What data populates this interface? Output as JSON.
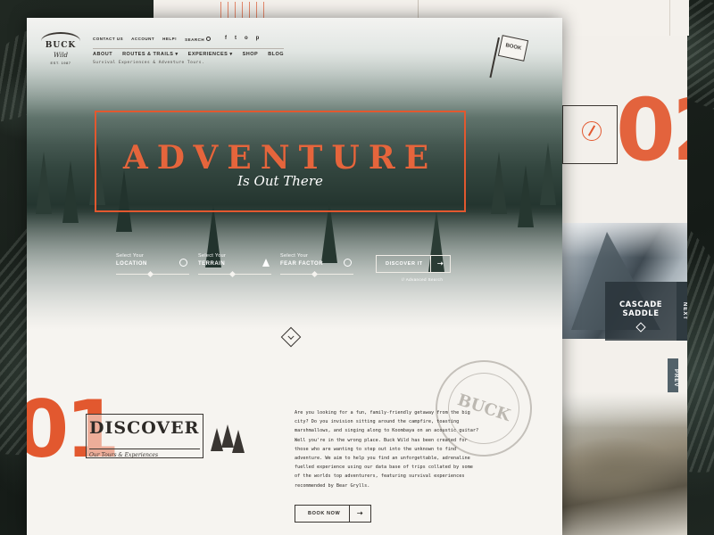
{
  "logo": {
    "name": "BUCK",
    "script": "Wild",
    "est": "EST. 1987"
  },
  "util_nav": {
    "contact": "CONTACT US",
    "account": "ACCOUNT",
    "help": "HELP!",
    "search": "SEARCH"
  },
  "social": [
    "f",
    "t",
    "o",
    "p"
  ],
  "main_nav": {
    "about": "ABOUT",
    "routes": "ROUTES & TRAILS",
    "experiences": "EXPERIENCES",
    "shop": "SHOP",
    "blog": "BLOG"
  },
  "tagline": "Survival Experiences & Adventure Tours.",
  "book_flag": "BOOK",
  "hero": {
    "title": "ADVENTURE",
    "subtitle": "Is Out There"
  },
  "filters": [
    {
      "label": "Select Your",
      "value": "LOCATION",
      "icon": "compass-icon"
    },
    {
      "label": "Select Your",
      "value": "TERRAIN",
      "icon": "tree-icon"
    },
    {
      "label": "Select Your",
      "value": "FEAR FACTOR",
      "icon": "skull-icon"
    }
  ],
  "discover_button": "DISCOVER IT",
  "advanced_search": "// Advanced Search",
  "section_01": {
    "number": "01",
    "title": "DISCOVER",
    "subtitle": "Our Tours & Experiences",
    "body": "Are you looking for a fun, family-friendly getaway from the big city? Do you invision sitting around the campfire, toasting marshmallows, and singing along to Koombaya on an acoustic guitar? Well you're in the wrong place. Buck Wild has been created for those who are wanting to step out into the unknown to find adventure. We aim to help you find an unforgettable, adrenaline fuelled experience using our data base of trips collated by some of the worlds top adventurers, featuring survival experiences recommended by Bear Grylls.",
    "book_button": "BOOK NOW"
  },
  "stamp_text": "BUCK",
  "side_page": {
    "number": "02",
    "card_title_line1": "CASCADE",
    "card_title_line2": "SADDLE",
    "next": "NEXT",
    "prev": "PREV"
  },
  "colors": {
    "accent": "#e2582f",
    "ink": "#2d2a27",
    "paper": "#f6f4f0"
  }
}
